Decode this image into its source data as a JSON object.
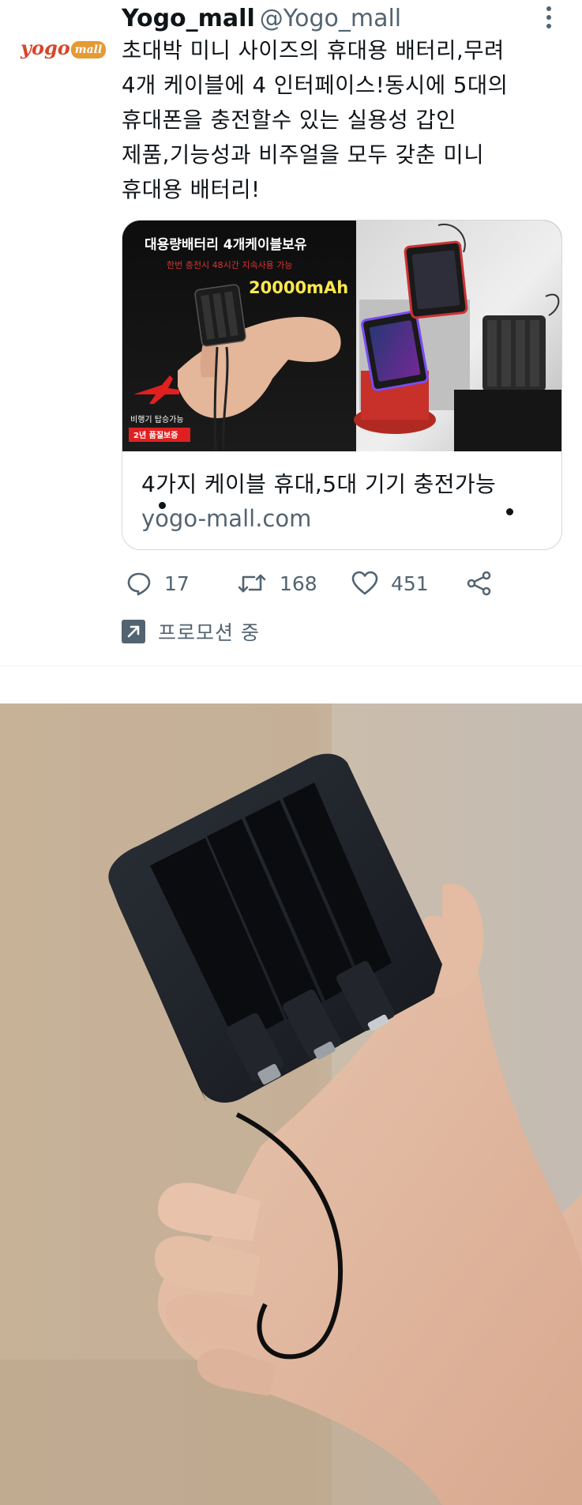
{
  "tweet": {
    "avatar_text": "yogo",
    "avatar_badge": "mall",
    "display_name": "Yogo_mall",
    "handle": "@Yogo_mall",
    "lines": [
      "초대박 미니 사이즈의 휴대용 배터리,무려",
      "4개 케이블에 4 인터페이스!동시에 5대의",
      "휴대폰을 충전할수 있는 실용성 갑인",
      "제품,기능성과 비주얼을 모두 갖춘 미니",
      "휴대용 배터리!"
    ]
  },
  "card": {
    "image_text": {
      "headline": "대용량배터리   4개케이블보유",
      "subline": "한번 충전시 48시간 지속사용 가능",
      "capacity": "20000mAh",
      "badge_line1": "비행기 탑승가능",
      "badge_line2": "2년 품질보증"
    },
    "title": "4가지 케이블 휴대,5대 기기 충전가능",
    "domain": "yogo-mall.com"
  },
  "actions": {
    "reply_count": "17",
    "retweet_count": "168",
    "like_count": "451"
  },
  "promoted_label": "프로모션 중",
  "colors": {
    "text_primary": "#0f1419",
    "text_secondary": "#536471",
    "border": "#cfd9de",
    "brand_red": "#d9462a",
    "brand_orange": "#e59a34"
  }
}
